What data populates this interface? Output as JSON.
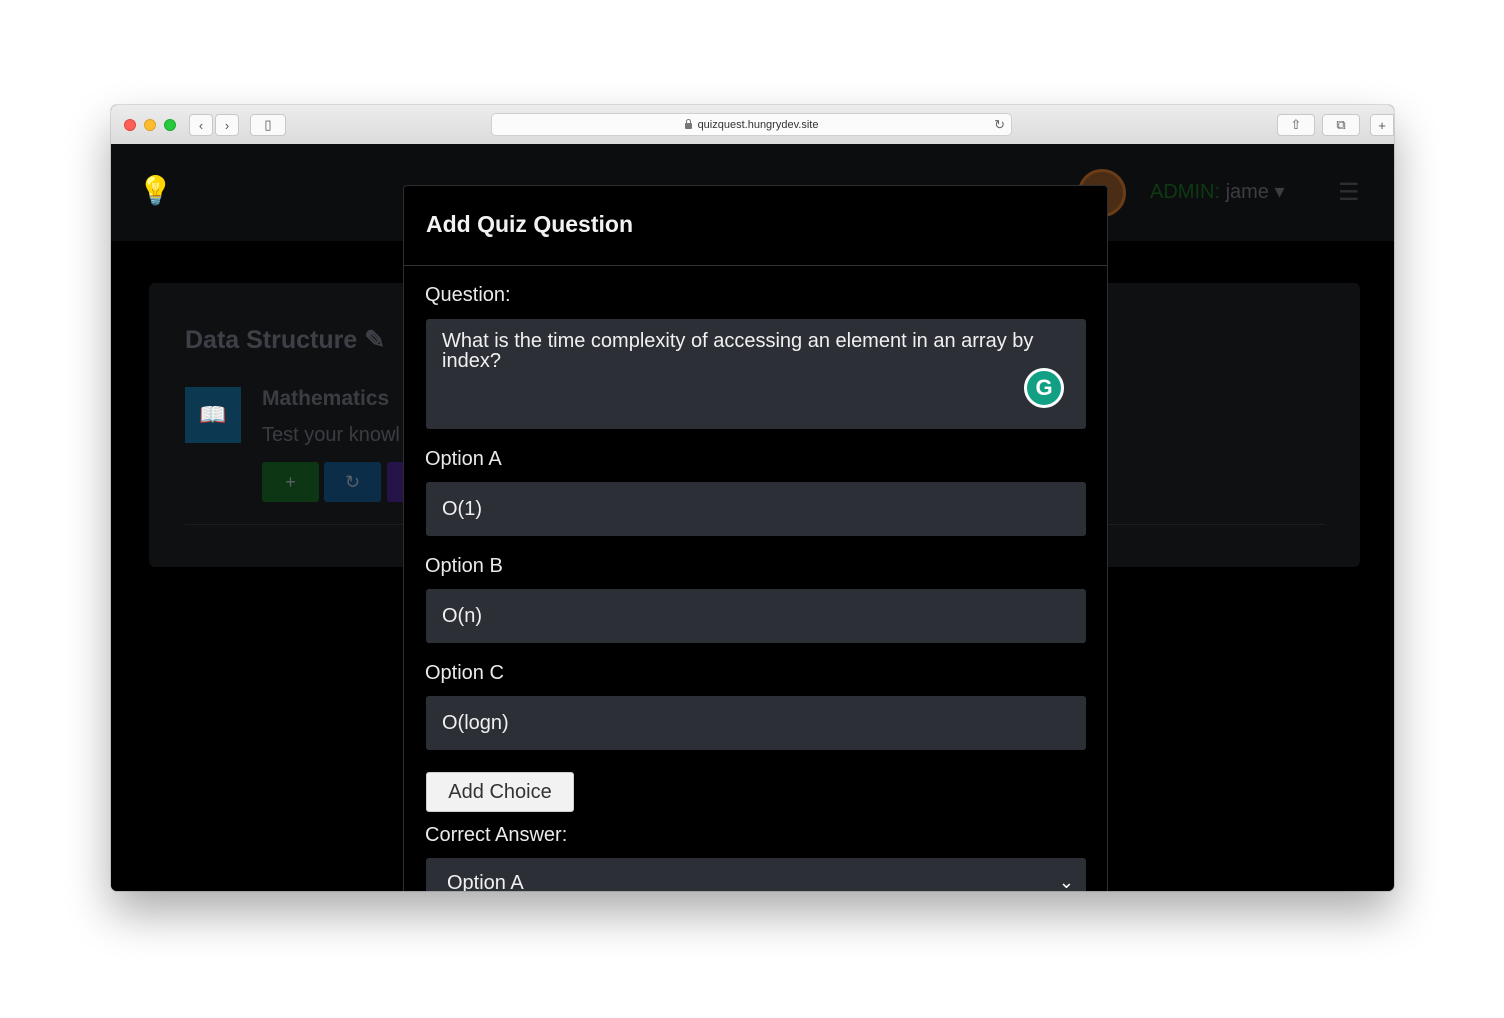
{
  "browser": {
    "url": "quizquest.hungrydev.site",
    "back_glyph": "‹",
    "forward_glyph": "›",
    "sidebar_glyph": "▯",
    "reload_glyph": "↻",
    "share_glyph": "⇧",
    "tabs_glyph": "⧉",
    "new_tab_glyph": "+"
  },
  "navbar": {
    "logo_glyph": "💡",
    "admin_label": "ADMIN:",
    "username": "jame",
    "dropdown_caret": "▾",
    "menu_glyph": "☰"
  },
  "background_card": {
    "title": "Data Structure",
    "edit_glyph": "✎",
    "book_glyph": "📖",
    "quiz_name": "Mathematics",
    "quiz_desc": "Test your knowl",
    "add_glyph": "+",
    "refresh_glyph": "↻"
  },
  "modal": {
    "title": "Add Quiz Question",
    "question_label": "Question:",
    "question_value": "What is the time complexity of accessing an element in an array by index?",
    "grammarly_glyph": "G",
    "option_a_label": "Option A",
    "option_a_value": "O(1)",
    "option_b_label": "Option B",
    "option_b_value": "O(n)",
    "option_c_label": "Option C",
    "option_c_value": "O(logn)",
    "add_choice_label": "Add Choice",
    "correct_answer_label": "Correct Answer:",
    "correct_answer_value": "Option A",
    "select_chevron": "⌄"
  }
}
